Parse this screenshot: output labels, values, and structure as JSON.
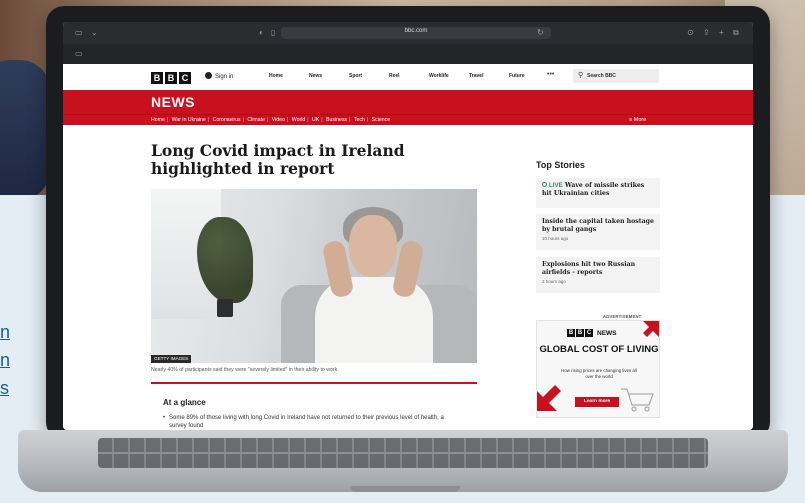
{
  "browser": {
    "url": "bbc.com"
  },
  "topnav": {
    "logo_letters": [
      "B",
      "B",
      "C"
    ],
    "sign_in": "Sign in",
    "items": [
      "Home",
      "News",
      "Sport",
      "Reel",
      "Worklife",
      "Travel",
      "Future"
    ],
    "more": "•••",
    "search_label": "Search BBC"
  },
  "news_banner": {
    "title": "NEWS"
  },
  "subnav": {
    "items": [
      "Home",
      "War in Ukraine",
      "Coronavirus",
      "Climate",
      "Video",
      "World",
      "UK",
      "Business",
      "Tech",
      "Science"
    ],
    "more": "≡ More"
  },
  "article": {
    "headline": "Long Covid impact in Ireland highlighted in report",
    "image_credit": "GETTY IMAGES",
    "caption": "Nearly 40% of participants said they were \"severely limited\" in their ability to work",
    "glance_title": "At a glance",
    "glance_items": [
      "Some 89% of those living with long Covid in Ireland have not returned to their previous level of health, a survey found"
    ]
  },
  "sidebar": {
    "title": "Top Stories",
    "stories": [
      {
        "live": "LIVE",
        "title": "Wave of missile strikes hit Ukrainian cities",
        "time": ""
      },
      {
        "live": "",
        "title": "Inside the capital taken hostage by brutal gangs",
        "time": "10 hours ago"
      },
      {
        "live": "",
        "title": "Explosions hit two Russian airfields - reports",
        "time": "2 hours ago"
      }
    ]
  },
  "advert": {
    "label": "ADVERTISEMENT",
    "brand": "NEWS",
    "headline": "GLOBAL COST OF LIVING",
    "sub": "How rising prices are changing lives all over the world",
    "button": "Learn more"
  },
  "page_side_links": [
    "n",
    "n",
    "s"
  ],
  "colors": {
    "bbc_red": "#c8101e",
    "live_green": "#2e8b57",
    "link_blue": "#1f5b8a"
  }
}
